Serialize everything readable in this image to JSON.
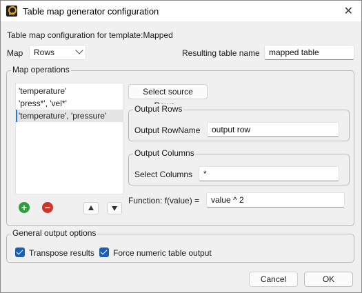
{
  "window": {
    "title": "Table map generator configuration",
    "close_glyph": "✕",
    "app_icon_text": "DR"
  },
  "header": {
    "config_label": "Table map configuration for template:Mapped"
  },
  "map": {
    "label": "Map",
    "selected": "Rows"
  },
  "resulting_table": {
    "label": "Resulting table name",
    "value": "mapped table"
  },
  "map_operations": {
    "group_label": "Map operations",
    "items": [
      "'temperature'",
      "'press*', 'vel*'",
      "'temperature', 'pressure'"
    ],
    "selected_index": 2,
    "select_source_button": "Select source Rows...",
    "add_icon": "+",
    "remove_icon": "−"
  },
  "output_rows": {
    "group_label": "Output Rows",
    "field_label": "Output RowName",
    "value": "output row"
  },
  "output_columns": {
    "group_label": "Output Columns",
    "field_label": "Select Columns",
    "value": "*"
  },
  "function": {
    "label": "Function: f(value) =",
    "value": "value ^ 2"
  },
  "general_options": {
    "group_label": "General output options",
    "transpose_label": "Transpose results",
    "transpose_checked": true,
    "force_numeric_label": "Force numeric table output",
    "force_numeric_checked": true
  },
  "footer": {
    "cancel_label": "Cancel",
    "ok_label": "OK"
  },
  "colors": {
    "accent": "#1a5fb4",
    "add": "#2e9e3c",
    "remove": "#d0352b"
  }
}
